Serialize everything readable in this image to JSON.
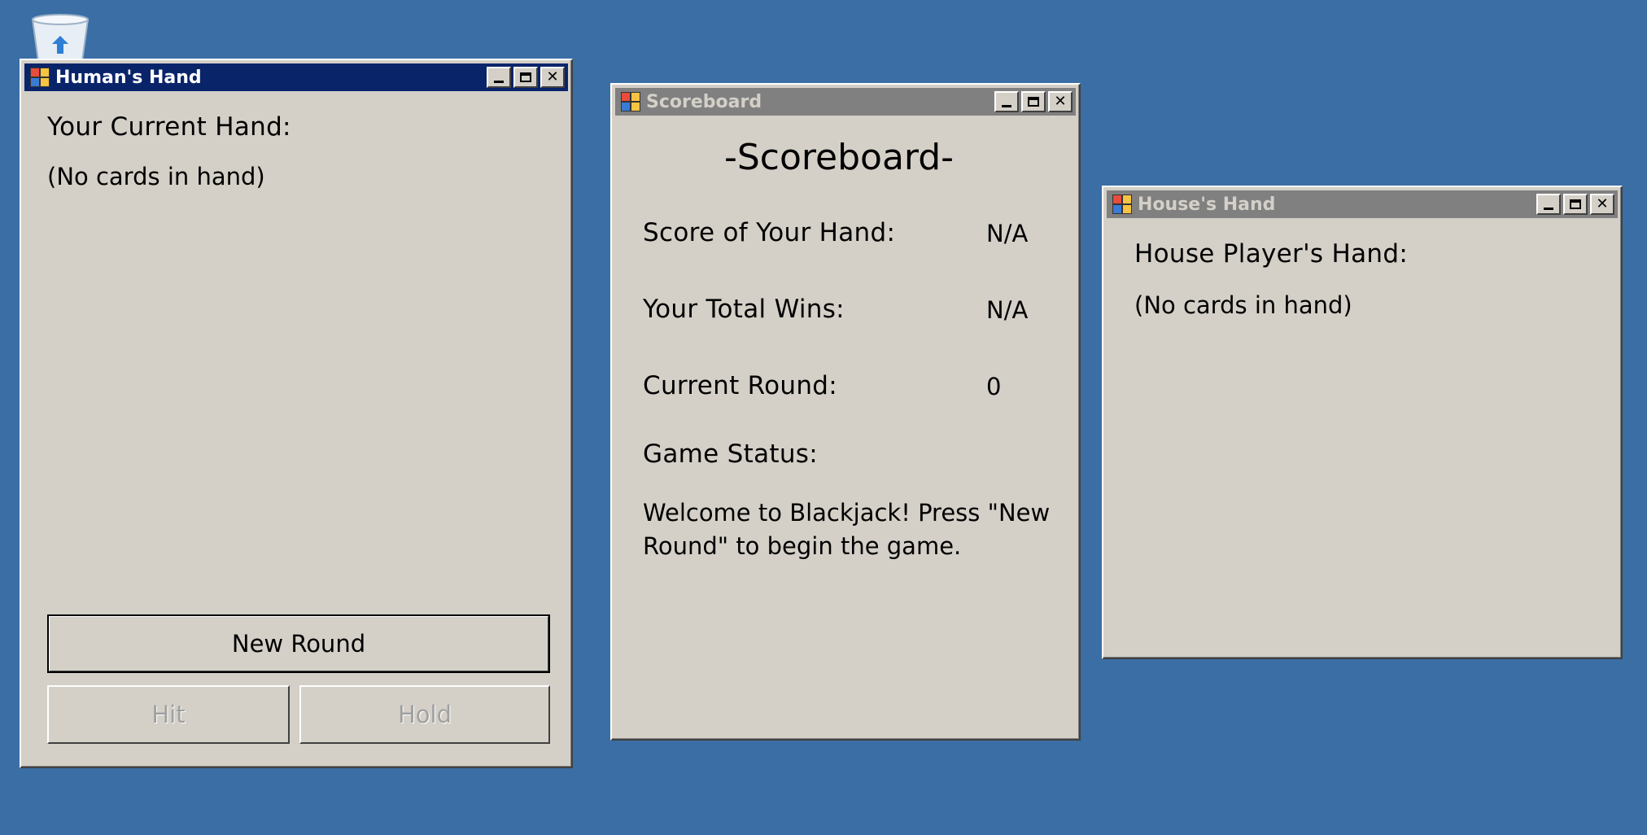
{
  "desktop": {
    "recycle_bin_icon": "recycle-bin-icon"
  },
  "human_window": {
    "title": "Human's Hand",
    "heading": "Your Current Hand:",
    "cards_text": "(No cards in hand)",
    "new_round_label": "New Round",
    "hit_label": "Hit",
    "hold_label": "Hold"
  },
  "scoreboard_window": {
    "title": "Scoreboard",
    "heading": "-Scoreboard-",
    "rows": [
      {
        "label": "Score of Your Hand:",
        "value": "N/A"
      },
      {
        "label": "Your Total Wins:",
        "value": "N/A"
      },
      {
        "label": "Current Round:",
        "value": "0"
      }
    ],
    "status_label": "Game Status:",
    "status_message": "Welcome to Blackjack! Press \"New Round\" to begin the game."
  },
  "house_window": {
    "title": "House's Hand",
    "heading": "House Player's Hand:",
    "cards_text": "(No cards in hand)"
  },
  "colors": {
    "desktop": "#3a6ea5",
    "window_face": "#d4d0c8",
    "active_title": "#0a246a",
    "inactive_title": "#808080"
  }
}
